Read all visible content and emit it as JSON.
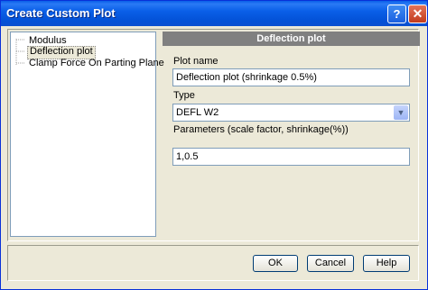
{
  "window": {
    "title": "Create Custom Plot",
    "help_glyph": "?",
    "close_glyph": "✕"
  },
  "tree": {
    "items": [
      {
        "label": "Modulus"
      },
      {
        "label": "Deflection plot"
      },
      {
        "label": "Clamp Force On Parting Plane"
      }
    ],
    "selected": "Deflection plot"
  },
  "panel": {
    "header": "Deflection plot",
    "plot_name_label": "Plot name",
    "plot_name_value": "Deflection plot (shrinkage 0.5%)",
    "type_label": "Type",
    "type_value": "DEFL W2",
    "params_label": "Parameters (scale factor, shrinkage(%))",
    "params_value": "1,0.5"
  },
  "buttons": {
    "ok": "OK",
    "cancel": "Cancel",
    "help": "Help"
  },
  "icons": {
    "dropdown": "chevron-down-icon",
    "help": "question-icon",
    "close": "close-icon"
  }
}
